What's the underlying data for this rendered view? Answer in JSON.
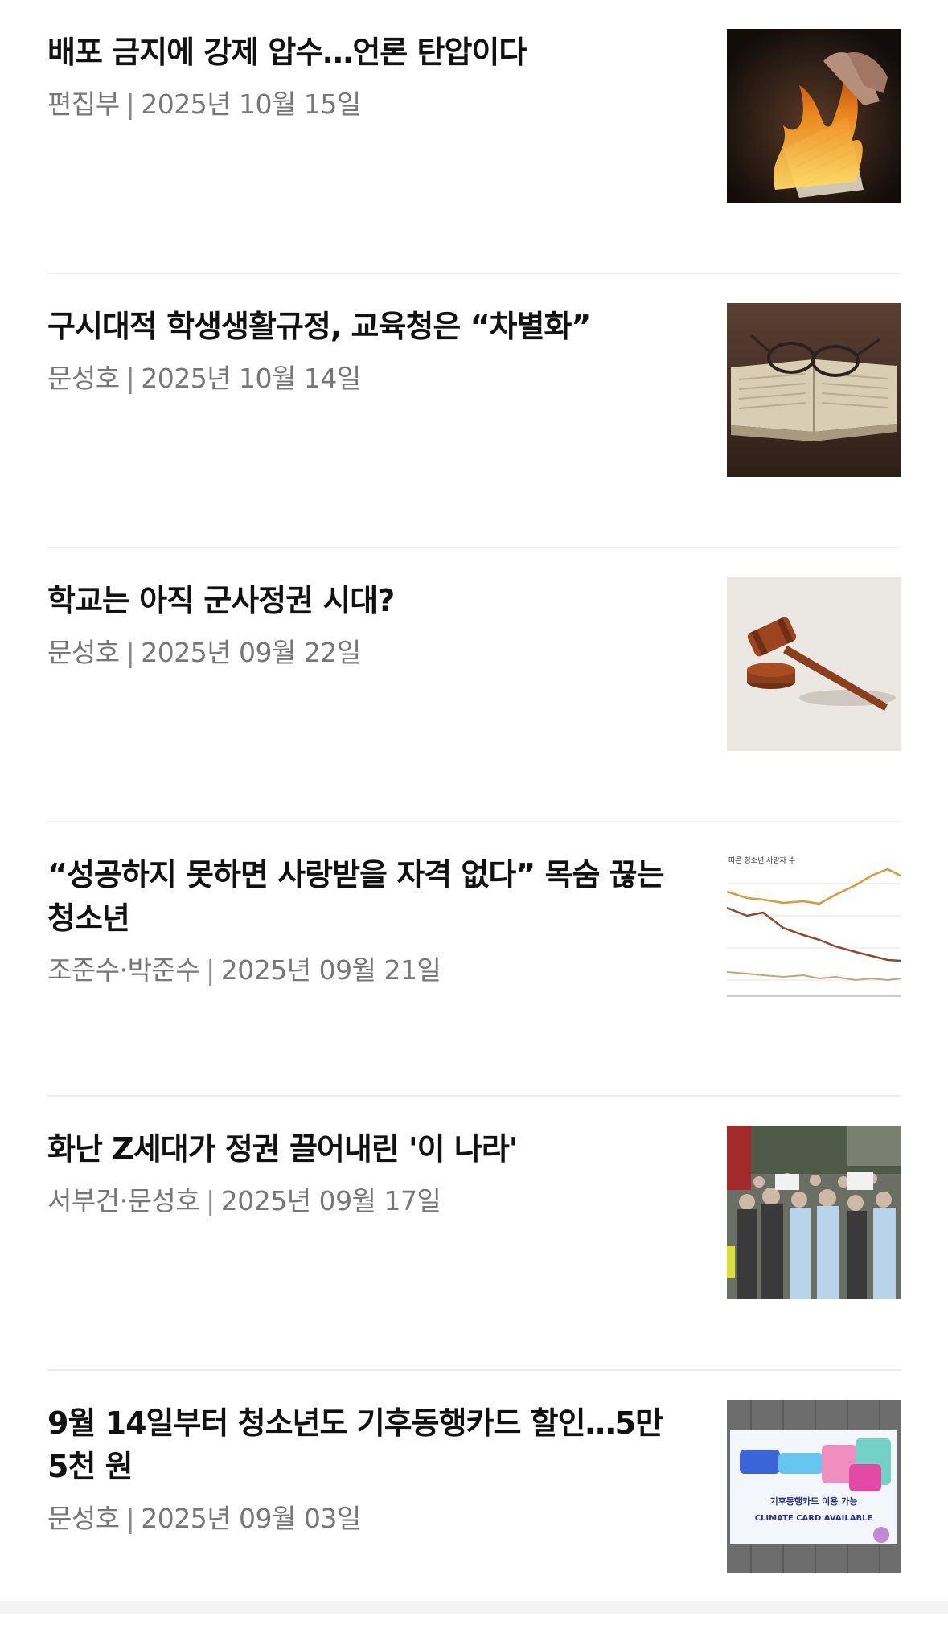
{
  "articles": [
    {
      "title": "배포 금지에 강제 압수…언론 탄압이다",
      "author": "편집부",
      "date": "2025년 10월 15일",
      "thumb": "burning-newspaper-image"
    },
    {
      "title": "구시대적 학생생활규정, 교육청은 “차별화”",
      "author": "문성호",
      "date": "2025년 10월 14일",
      "thumb": "book-and-glasses-image"
    },
    {
      "title": "학교는 아직 군사정권 시대?",
      "author": "문성호",
      "date": "2025년 09월 22일",
      "thumb": "gavel-image"
    },
    {
      "title": "“성공하지 못하면 사랑받을 자격 없다” 목숨 끊는 청소년",
      "author": "조준수·박준수",
      "date": "2025년 09월 21일",
      "thumb": "youth-death-chart-image",
      "thumb_caption": "따른 청소년 사망자 수"
    },
    {
      "title": "화난 Z세대가 정권 끌어내린 '이 나라'",
      "author": "서부건·문성호",
      "date": "2025년 09월 17일",
      "thumb": "student-protest-image"
    },
    {
      "title": "9월 14일부터 청소년도 기후동행카드 할인…5만 5천 원",
      "author": "문성호",
      "date": "2025년 09월 03일",
      "thumb": "climate-card-poster-image",
      "thumb_text1": "기후동행카드 이용 가능",
      "thumb_text2": "CLIMATE CARD AVAILABLE"
    }
  ],
  "separator": "|"
}
